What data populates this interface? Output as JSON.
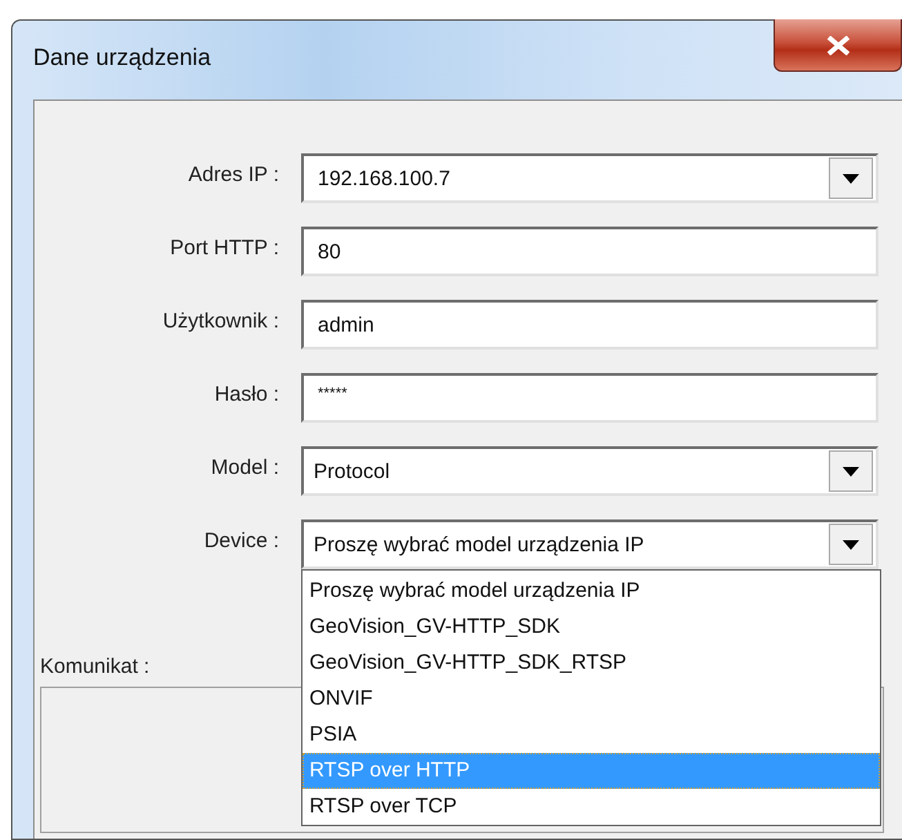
{
  "window": {
    "title": "Dane urządzenia"
  },
  "fields": [
    {
      "label": "Adres IP :",
      "kind": "combo",
      "value": "192.168.100.7"
    },
    {
      "label": "Port HTTP :",
      "kind": "text",
      "value": "80"
    },
    {
      "label": "Użytkownik :",
      "kind": "text",
      "value": "admin"
    },
    {
      "label": "Hasło :",
      "kind": "password",
      "value": "*****"
    },
    {
      "label": "Model :",
      "kind": "combo",
      "value": "Protocol"
    },
    {
      "label": "Device :",
      "kind": "combo",
      "value": "Proszę wybrać model urządzenia IP",
      "expanded": true
    }
  ],
  "message": {
    "label": "Komunikat :"
  },
  "dropdown": {
    "options": [
      {
        "label": "Proszę wybrać model urządzenia IP",
        "selected": false
      },
      {
        "label": "GeoVision_GV-HTTP_SDK",
        "selected": false
      },
      {
        "label": "GeoVision_GV-HTTP_SDK_RTSP",
        "selected": false
      },
      {
        "label": "ONVIF",
        "selected": false
      },
      {
        "label": "PSIA",
        "selected": false
      },
      {
        "label": "RTSP over HTTP",
        "selected": true
      },
      {
        "label": "RTSP over TCP",
        "selected": false
      }
    ]
  }
}
